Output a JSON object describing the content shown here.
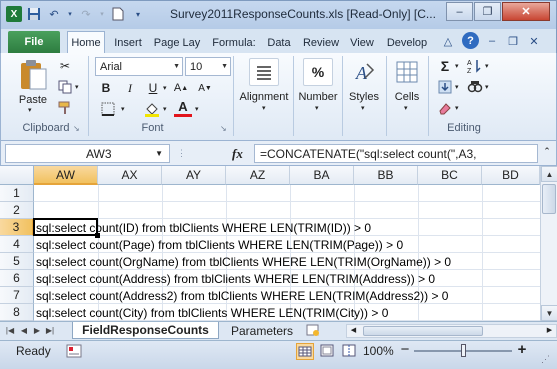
{
  "window": {
    "title": "Survey2011ResponseCounts.xls  [Read-Only]  [C...",
    "controls": [
      "–",
      "❐",
      "✕"
    ]
  },
  "ribbon_tabs": {
    "file": "File",
    "home": "Home",
    "insert": "Insert",
    "page_layout": "Page Lay",
    "formulas": "Formula:",
    "data": "Data",
    "review": "Review",
    "view": "View",
    "developer": "Develop"
  },
  "ribbon": {
    "clipboard": {
      "paste_label": "Paste",
      "group_label": "Clipboard"
    },
    "font": {
      "name": "Arial",
      "size": "10",
      "group_label": "Font",
      "bold": "B",
      "italic": "I",
      "underline": "U",
      "font_color_letter": "A"
    },
    "alignment": {
      "label": "Alignment"
    },
    "number": {
      "label": "Number",
      "symbol": "%"
    },
    "styles": {
      "label": "Styles"
    },
    "cells": {
      "label": "Cells"
    },
    "editing": {
      "group_label": "Editing",
      "sum_symbol": "Σ"
    }
  },
  "formula_bar": {
    "name_box": "AW3",
    "fx": "fx",
    "formula": "=CONCATENATE(\"sql:select count(\",A3,"
  },
  "columns": [
    "AW",
    "AX",
    "AY",
    "AZ",
    "BA",
    "BB",
    "BC",
    "BD"
  ],
  "rows": [
    {
      "num": "1",
      "text": ""
    },
    {
      "num": "2",
      "text": ""
    },
    {
      "num": "3",
      "text": "sql:select count(ID) from tblClients WHERE LEN(TRIM(ID)) > 0"
    },
    {
      "num": "4",
      "text": "sql:select count(Page) from tblClients WHERE LEN(TRIM(Page)) > 0"
    },
    {
      "num": "5",
      "text": "sql:select count(OrgName) from tblClients WHERE LEN(TRIM(OrgName)) > 0"
    },
    {
      "num": "6",
      "text": "sql:select count(Address) from tblClients WHERE LEN(TRIM(Address)) > 0"
    },
    {
      "num": "7",
      "text": "sql:select count(Address2) from tblClients WHERE LEN(TRIM(Address2)) > 0"
    },
    {
      "num": "8",
      "text": "sql:select count(City) from tblClients WHERE LEN(TRIM(City)) > 0"
    }
  ],
  "sheets": [
    "FieldResponseCounts",
    "Parameters"
  ],
  "status": {
    "ready": "Ready",
    "zoom": "100%",
    "zoom_minus": "−",
    "zoom_plus": "+"
  },
  "colors": {
    "file_tab": "#2d7d40",
    "selected_header": "#f1c15f",
    "accent": "#2a4e86"
  }
}
